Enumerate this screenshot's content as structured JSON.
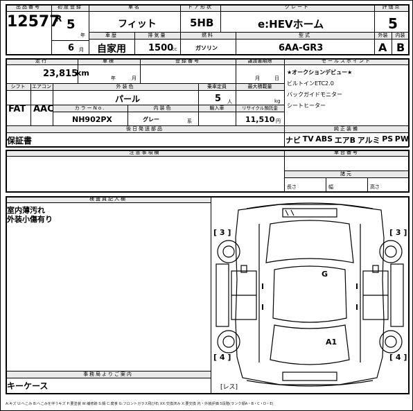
{
  "header": {
    "lot_label": "出品番号",
    "lot_number": "12577",
    "first_reg_label": "初度登録",
    "era": "R",
    "year_num": "5",
    "year_unit": "年",
    "month_num": "6",
    "month_unit": "月",
    "car_name_label": "車名",
    "car_name": "フィット",
    "door_label": "ドア形状",
    "door_value": "5HB",
    "grade_label": "グレード",
    "grade_value": "e:HEVホーム",
    "score_label": "評価点",
    "score_value": "5",
    "history_label": "車歴",
    "history_value": "自家用",
    "displacement_label": "排気量",
    "displacement_value": "1500",
    "displacement_unit": "cc",
    "fuel_label": "燃料",
    "fuel_value": "ガソリン",
    "model_label": "型式",
    "model_value": "6AA-GR3",
    "exterior_grade_label": "外装",
    "interior_grade_label": "内装",
    "exterior_grade_value": "A",
    "interior_grade_value": "B"
  },
  "details": {
    "mileage_label": "走行",
    "mileage_value": "23,815",
    "mileage_unit": "km",
    "inspection_label": "車検",
    "inspection_year_unit": "年",
    "inspection_month_unit": "月",
    "registration_label": "登録番号",
    "transfer_label": "譲渡書期限",
    "transfer_month_unit": "月",
    "transfer_day_unit": "日",
    "shift_label": "シフト",
    "ac_label": "エアコン",
    "shift_value": "FAT",
    "ac_value": "AAC",
    "ext_color_label": "外装色",
    "ext_color_value": "パール",
    "capacity_label": "乗車定員",
    "capacity_value": "5",
    "capacity_unit": "人",
    "load_label": "最大積載量",
    "load_unit": "kg",
    "color_no_label": "カラーNo.",
    "color_no_value": "NH902PX",
    "int_color_label": "内装色",
    "int_color_value": "グレー",
    "int_color_suffix": "系",
    "import_label": "輸入車",
    "recycle_label": "リサイクル預託金",
    "recycle_value": "11,510",
    "recycle_unit": "円",
    "docs_label": "後日発送部品",
    "docs_value": "保証書"
  },
  "sales_points": {
    "label": "セールスポイント",
    "items": [
      "★オークションデビュー★",
      "ビルトインETC2.0",
      "バックガイドモニター",
      "シートヒーター"
    ]
  },
  "equipment": {
    "label": "純正装備",
    "items": [
      "ナビ",
      "TV",
      "ABS",
      "エアB",
      "アルミ",
      "PS",
      "PW"
    ]
  },
  "notes": {
    "caution_label": "注意事項欄",
    "chassis_label": "車台番号",
    "size_label": "諸元",
    "length_label": "長さ",
    "width_label": "幅",
    "height_label": "高さ"
  },
  "inspector": {
    "label": "検査員記入欄",
    "lines": [
      "室内薄汚れ",
      "外装小傷有り"
    ]
  },
  "office": {
    "label": "事務局よりご案内",
    "value": "キーケース"
  },
  "diagram": {
    "marks": [
      "[ 3 ]",
      "[ 3 ]",
      "[ 4 ]",
      "[ 4 ]"
    ],
    "damage_g": "G",
    "damage_a1": "A1",
    "less_label": "[レス]"
  },
  "legend": "A:キズ U:へこみ B:へこみを伴うキズ P:要塗装 W:補修跡 S:錆 C:腐食 G:フロントガラス飛び石 XX:交換済み X:要交換 内・外装評価 5段階(ランク順A・B・C・D・E)"
}
